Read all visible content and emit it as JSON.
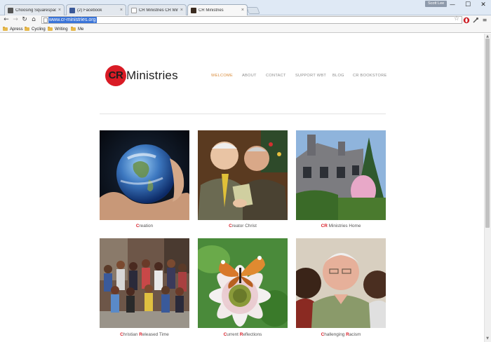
{
  "browser": {
    "tabs": [
      {
        "label": "Choosing Squarespace – ",
        "favicon_color": "#555555"
      },
      {
        "label": "(2) Facebook",
        "favicon_color": "#3b5998"
      },
      {
        "label": "CR Ministries CR Ministrie",
        "favicon_color": "#ffffff"
      },
      {
        "label": "CR Ministries",
        "favicon_color": "#3a2b20"
      }
    ],
    "profile_name": "Scott Lee",
    "window_controls": {
      "minimize": "—",
      "maximize": "☐",
      "close": "✕"
    },
    "nav_icons": {
      "back": "←",
      "forward": "→",
      "reload": "↻",
      "home": "⌂"
    },
    "url": "www.cr-ministries.org",
    "star_icon": "☆",
    "menu_icon": "≡",
    "bookmarks": [
      "Apress",
      "Cycling",
      "Writing",
      "Me"
    ]
  },
  "site": {
    "logo": {
      "initials": "CR",
      "name": "Ministries",
      "accent": "#d91b25"
    },
    "nav": [
      "WELCOME",
      "ABOUT",
      "CONTACT",
      "SUPPORT WBT",
      "BLOG",
      "CR BOOKSTORE"
    ],
    "nav_active_color": "#d88a38",
    "tiles": [
      {
        "red": "C",
        "rest": "reation"
      },
      {
        "red": "C",
        "rest": "reator Christ"
      },
      {
        "red": "CR",
        "rest": " Ministries Home"
      },
      {
        "parts": [
          {
            "red": "C",
            "rest": "hristian "
          },
          {
            "red": "R",
            "rest": "eleased Time"
          }
        ]
      },
      {
        "parts": [
          {
            "red": "C",
            "rest": "urrent "
          },
          {
            "red": "R",
            "rest": "eflections"
          }
        ]
      },
      {
        "parts": [
          {
            "red": "C",
            "rest": "hallenging "
          },
          {
            "red": "R",
            "rest": "acism"
          }
        ]
      }
    ]
  }
}
